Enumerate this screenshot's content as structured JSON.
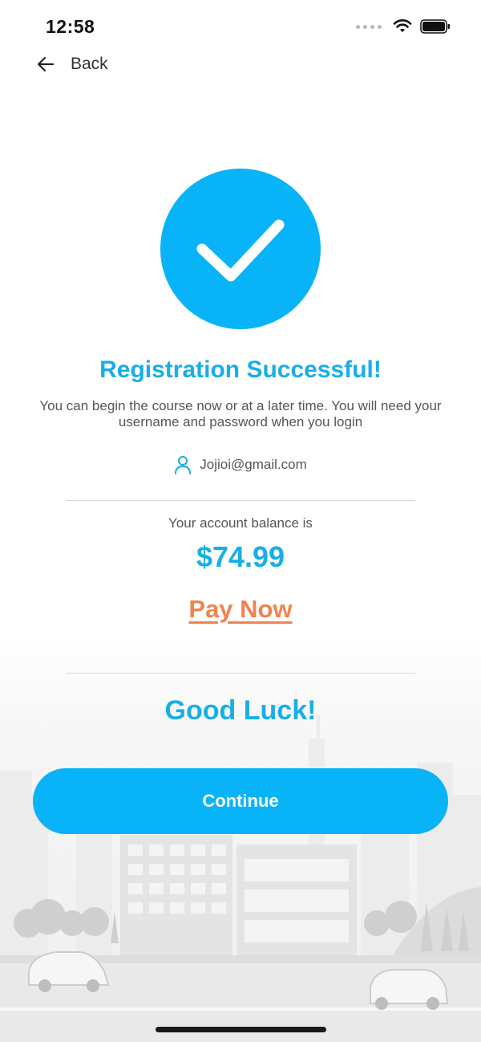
{
  "status_bar": {
    "time": "12:58"
  },
  "nav": {
    "back_label": "Back"
  },
  "header": {
    "title": "Registration Successful!",
    "subtitle": "You can begin the course now or at a later time. You will need your username and password when you login"
  },
  "account": {
    "email": "Jojioi@gmail.com",
    "balance_label": "Your account balance is",
    "balance": "$74.99",
    "pay_now_label": "Pay Now"
  },
  "footer": {
    "good_luck": "Good Luck!",
    "continue_label": "Continue"
  },
  "colors": {
    "accent": "#08b4f7",
    "title_blue": "#18aee8",
    "pay_orange": "#f0834e",
    "text_gray": "#555555"
  },
  "icons": [
    "back-arrow-icon",
    "checkmark-icon",
    "user-icon",
    "wifi-icon",
    "battery-icon",
    "signal-dots-icon"
  ]
}
